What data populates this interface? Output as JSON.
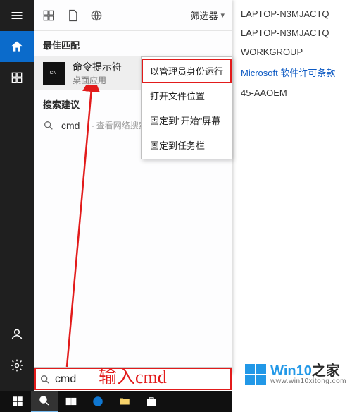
{
  "rail": {
    "top": [
      {
        "name": "hamburger",
        "active": false
      },
      {
        "name": "home",
        "active": true
      },
      {
        "name": "apps",
        "active": false
      }
    ],
    "bottom": [
      {
        "name": "account",
        "active": false
      },
      {
        "name": "settings",
        "active": false
      },
      {
        "name": "feedback",
        "active": false
      }
    ]
  },
  "panel": {
    "filter_label": "筛选器",
    "best_group_title": "最佳匹配",
    "best_result": {
      "title": "命令提示符",
      "subtitle": "桌面应用"
    },
    "suggest_group_title": "搜索建议",
    "suggestion": {
      "text": "cmd",
      "hint": "- 查看网络搜索结果"
    }
  },
  "context_menu": {
    "items": [
      {
        "label": "以管理员身份运行",
        "highlight": true
      },
      {
        "label": "打开文件位置",
        "highlight": false
      },
      {
        "label": "固定到\"开始\"屏幕",
        "highlight": false
      },
      {
        "label": "固定到任务栏",
        "highlight": false
      }
    ]
  },
  "search_box": {
    "value": "cmd"
  },
  "sysinfo": {
    "line1": "LAPTOP-N3MJACTQ",
    "line2": "LAPTOP-N3MJACTQ",
    "line3": "WORKGROUP",
    "line4": "Microsoft 软件许可条款",
    "line5": "45-AAOEM"
  },
  "annotation": "输入cmd",
  "watermark": {
    "title_a": "Win",
    "title_b": "10",
    "title_c": "之家",
    "url": "www.win10xitong.com"
  },
  "colors": {
    "accent": "#0b6bcb",
    "annotation": "#e21b1b"
  }
}
